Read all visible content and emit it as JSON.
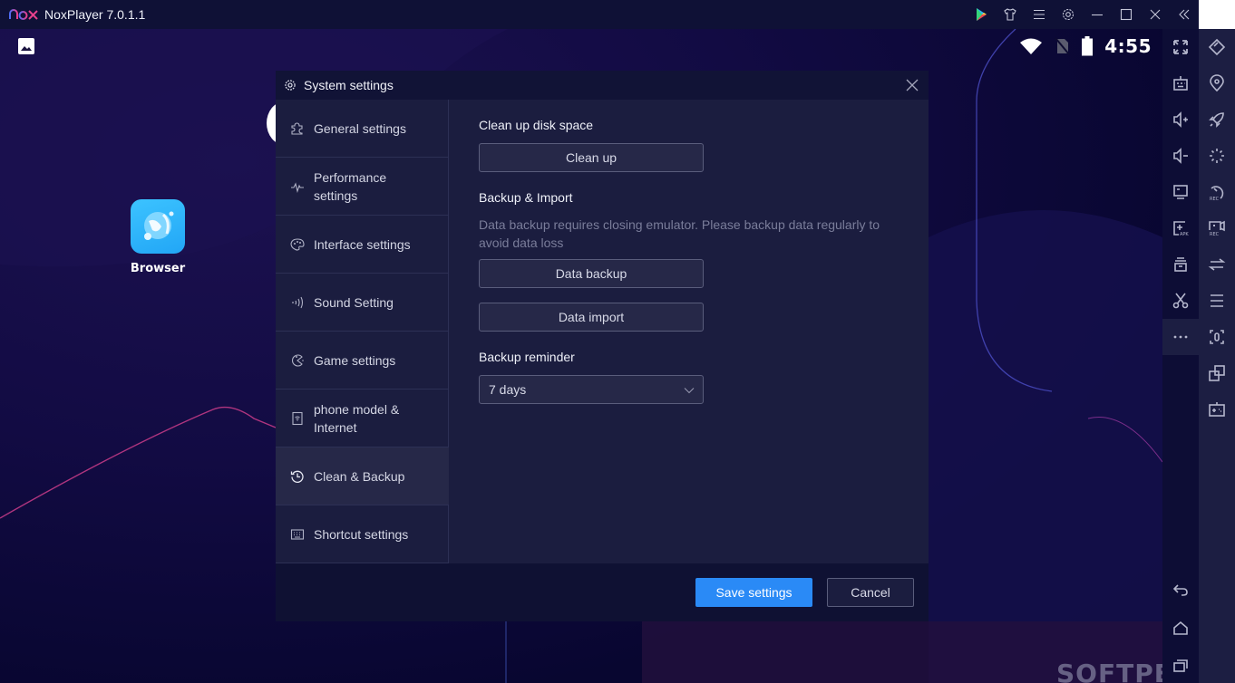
{
  "window": {
    "app_title": "NoxPlayer 7.0.1.1",
    "controls": [
      "play-store",
      "theme",
      "menu",
      "settings",
      "minimize",
      "maximize",
      "close",
      "collapse-sidebar"
    ]
  },
  "android": {
    "clock": "4:55",
    "status_icons": [
      "wifi",
      "no-sim",
      "battery"
    ],
    "desktop_apps": [
      {
        "label": "Browser",
        "icon": "browser-icon"
      }
    ]
  },
  "sidebar": {
    "left_column": [
      "fullscreen",
      "keyboard-mapping",
      "volume-up",
      "volume-down",
      "screen",
      "install-apk",
      "multi-drive",
      "screenshot-scissors",
      "more"
    ],
    "right_column": [
      "rotate",
      "location",
      "rocket-boost",
      "loading",
      "record-macro",
      "record-video",
      "sync",
      "menu",
      "capture",
      "multi-instance",
      "gamepad"
    ],
    "bottom": [
      "back",
      "home",
      "recent-apps"
    ]
  },
  "dialog": {
    "title": "System settings",
    "nav": [
      {
        "label": "General settings",
        "icon": "puzzle-icon"
      },
      {
        "label": "Performance settings",
        "icon": "pulse-icon"
      },
      {
        "label": "Interface settings",
        "icon": "palette-icon"
      },
      {
        "label": "Sound Setting",
        "icon": "sound-icon"
      },
      {
        "label": "Game settings",
        "icon": "game-icon"
      },
      {
        "label": "phone model & Internet",
        "icon": "phone-wifi-icon"
      },
      {
        "label": "Clean & Backup",
        "icon": "history-icon",
        "active": true
      },
      {
        "label": "Shortcut settings",
        "icon": "keyboard-icon"
      }
    ],
    "content": {
      "cleanup_title": "Clean up disk space",
      "cleanup_button": "Clean up",
      "backup_title": "Backup & Import",
      "backup_desc": "Data backup requires closing emulator. Please backup data regularly to avoid data loss",
      "backup_button": "Data backup",
      "import_button": "Data import",
      "reminder_title": "Backup reminder",
      "reminder_value": "7 days"
    },
    "footer": {
      "save_label": "Save settings",
      "cancel_label": "Cancel"
    }
  },
  "watermark": "SOFTPEDIA",
  "colors": {
    "accent": "#2a8af6",
    "dialog_bg": "#1b1d3f",
    "titlebar_bg": "#0f1136"
  }
}
